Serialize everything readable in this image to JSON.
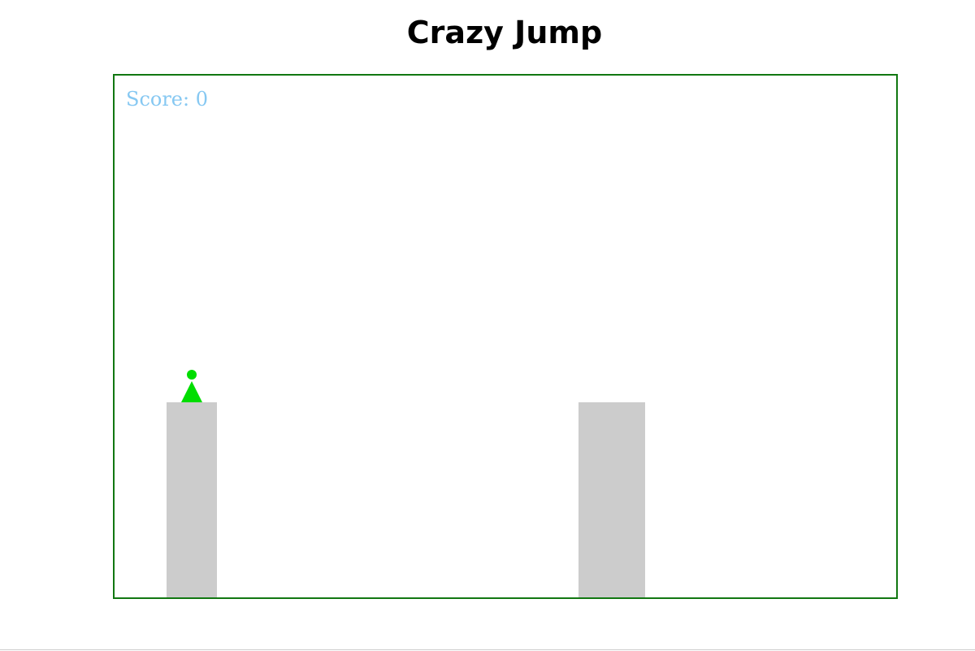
{
  "title": "Crazy Jump",
  "score": {
    "label": "Score:",
    "value": 0
  },
  "game": {
    "platforms": [
      {
        "name": "start-platform"
      },
      {
        "name": "target-platform"
      }
    ],
    "player": {
      "shape": "green-cone-with-head"
    }
  },
  "colors": {
    "border": "#117711",
    "score_text": "#86c8f2",
    "platform": "#cccccc",
    "player": "#00dd00"
  }
}
